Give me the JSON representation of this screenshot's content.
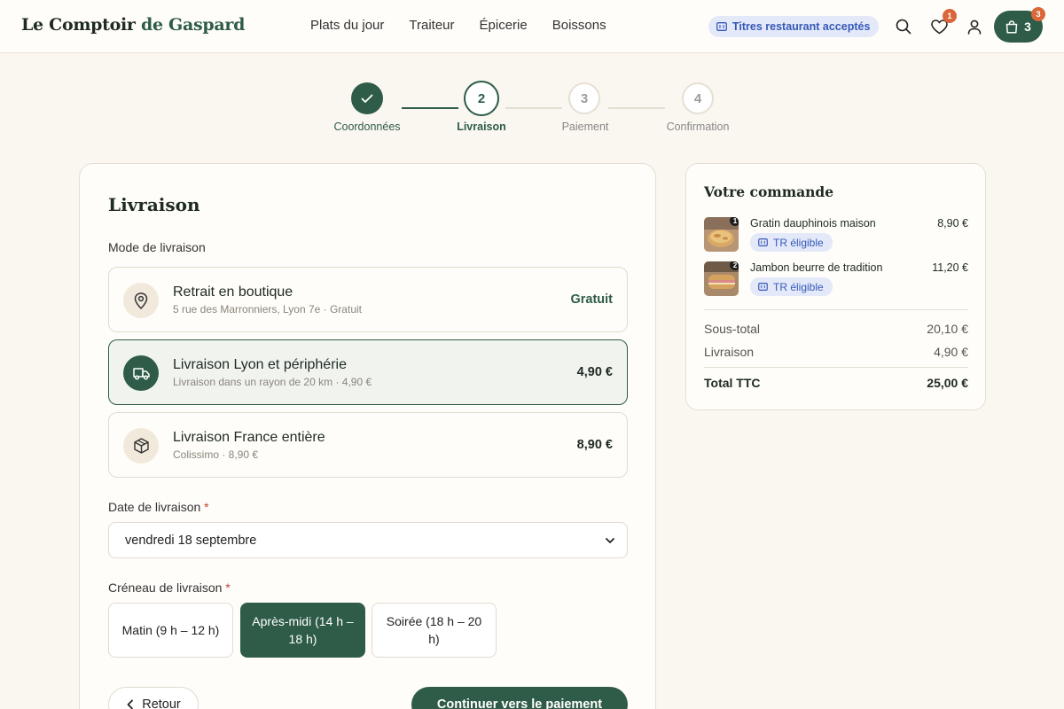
{
  "header": {
    "logo_main": "Le Comptoir",
    "logo_accent": "de Gaspard",
    "nav": [
      "Plats du jour",
      "Traiteur",
      "Épicerie",
      "Boissons"
    ],
    "tr_badge": "Titres restaurant acceptés",
    "wishlist_count": "1",
    "cart_count": "3",
    "cart_badge": "3"
  },
  "stepper": {
    "steps": [
      {
        "number": "1",
        "label": "Coordonnées",
        "state": "done"
      },
      {
        "number": "2",
        "label": "Livraison",
        "state": "active"
      },
      {
        "number": "3",
        "label": "Paiement",
        "state": "todo"
      },
      {
        "number": "4",
        "label": "Confirmation",
        "state": "todo"
      }
    ]
  },
  "delivery": {
    "title": "Livraison",
    "mode_label": "Mode de livraison",
    "options": [
      {
        "title": "Retrait en boutique",
        "subtitle": "5 rue des Marronniers, Lyon 7e · Gratuit",
        "price": "Gratuit",
        "icon": "map-pin-icon",
        "selected": false
      },
      {
        "title": "Livraison Lyon et périphérie",
        "subtitle": "Livraison dans un rayon de 20 km · 4,90 €",
        "price": "4,90 €",
        "icon": "truck-icon",
        "selected": true
      },
      {
        "title": "Livraison France entière",
        "subtitle": "Colissimo · 8,90 €",
        "price": "8,90 €",
        "icon": "package-icon",
        "selected": false
      }
    ],
    "date_label": "Date de livraison",
    "date_value": "vendredi 18 septembre",
    "slot_label": "Créneau de livraison",
    "required_mark": "*",
    "slots": [
      {
        "label": "Matin (9 h – 12 h)",
        "selected": false
      },
      {
        "label": "Après-midi (14 h – 18 h)",
        "selected": true
      },
      {
        "label": "Soirée (18 h – 20 h)",
        "selected": false
      }
    ],
    "back_label": "Retour",
    "continue_label": "Continuer vers le paiement"
  },
  "summary": {
    "title": "Votre commande",
    "items": [
      {
        "name": "Gratin dauphinois maison",
        "price": "8,90 €",
        "qty": "1",
        "tag": "TR éligible"
      },
      {
        "name": "Jambon beurre de tradition",
        "price": "11,20 €",
        "qty": "2",
        "tag": "TR éligible"
      }
    ],
    "subtotal_label": "Sous-total",
    "subtotal_value": "20,10 €",
    "shipping_label": "Livraison",
    "shipping_value": "4,90 €",
    "total_label": "Total TTC",
    "total_value": "25,00 €"
  },
  "colors": {
    "brand_green": "#2e5c48",
    "accent_orange": "#d9673a",
    "tr_blue": "#3758b8",
    "background": "#faf6f0"
  }
}
